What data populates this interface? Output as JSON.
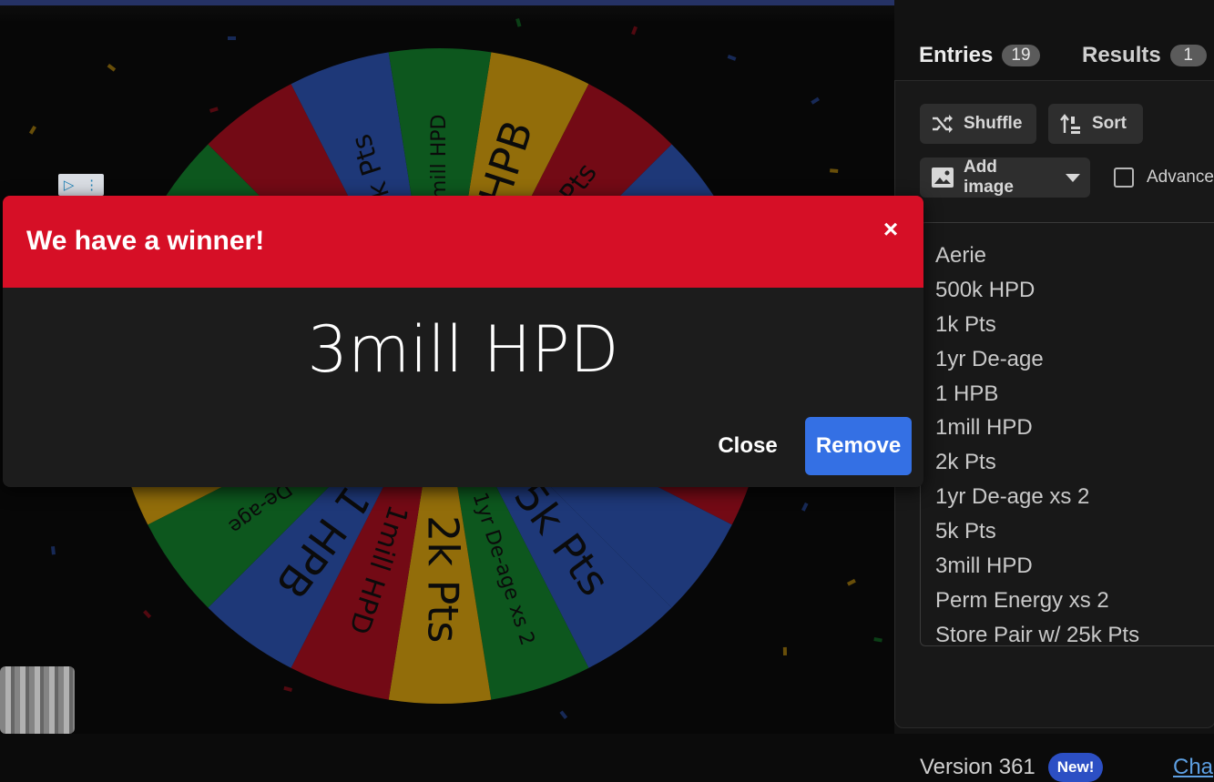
{
  "wheel": {
    "segments": [
      {
        "label": "2 HPB",
        "color": "#e0a810"
      },
      {
        "label": "7.5k Pts",
        "color": "#b11021"
      },
      {
        "label": "3mill HPD",
        "color": "#2f56b8"
      },
      {
        "label": "",
        "color": "#14862e"
      },
      {
        "label": "",
        "color": "#e0a810"
      },
      {
        "label": "",
        "color": "#b11021"
      },
      {
        "label": "",
        "color": "#2f56b8"
      },
      {
        "label": "5k Pts",
        "color": "#2f56b8"
      },
      {
        "label": "1yr De-age xs 2",
        "color": "#14862e"
      },
      {
        "label": "2k Pts",
        "color": "#e0a810"
      },
      {
        "label": "1mill HPD",
        "color": "#b11021"
      },
      {
        "label": "1 HPB",
        "color": "#2f56b8"
      },
      {
        "label": "1yr De-age",
        "color": "#14862e"
      },
      {
        "label": "1k Pts",
        "color": "#e0a810"
      },
      {
        "label": "",
        "color": "#b11021"
      },
      {
        "label": "",
        "color": "#2f56b8"
      },
      {
        "label": "",
        "color": "#14862e"
      },
      {
        "label": "",
        "color": "#b11021"
      },
      {
        "label": "10k Pts",
        "color": "#2f56b8"
      },
      {
        "label": "7.5mill HPD",
        "color": "#14862e"
      }
    ]
  },
  "ad": {
    "play_icon": "▷",
    "menu_icon": "⋮"
  },
  "modal": {
    "title": "We have a winner!",
    "close_symbol": "×",
    "winner": "3mill HPD",
    "close_label": "Close",
    "remove_label": "Remove"
  },
  "tabs": {
    "entries_label": "Entries",
    "entries_count": "19",
    "results_label": "Results",
    "results_count": "1"
  },
  "toolbar": {
    "shuffle_label": "Shuffle",
    "sort_label": "Sort",
    "add_image_label": "Add image",
    "advanced_label": "Advanced"
  },
  "entries": [
    "Aerie",
    "500k HPD",
    "1k Pts",
    "1yr De-age",
    "1 HPB",
    "1mill HPD",
    "2k Pts",
    "1yr De-age xs 2",
    "5k Pts",
    "3mill HPD",
    "Perm Energy xs 2",
    "Store Pair w/ 25k Pts"
  ],
  "footer": {
    "version_label": "Version 361",
    "new_badge": "New!",
    "changelog_label": "Cha"
  }
}
